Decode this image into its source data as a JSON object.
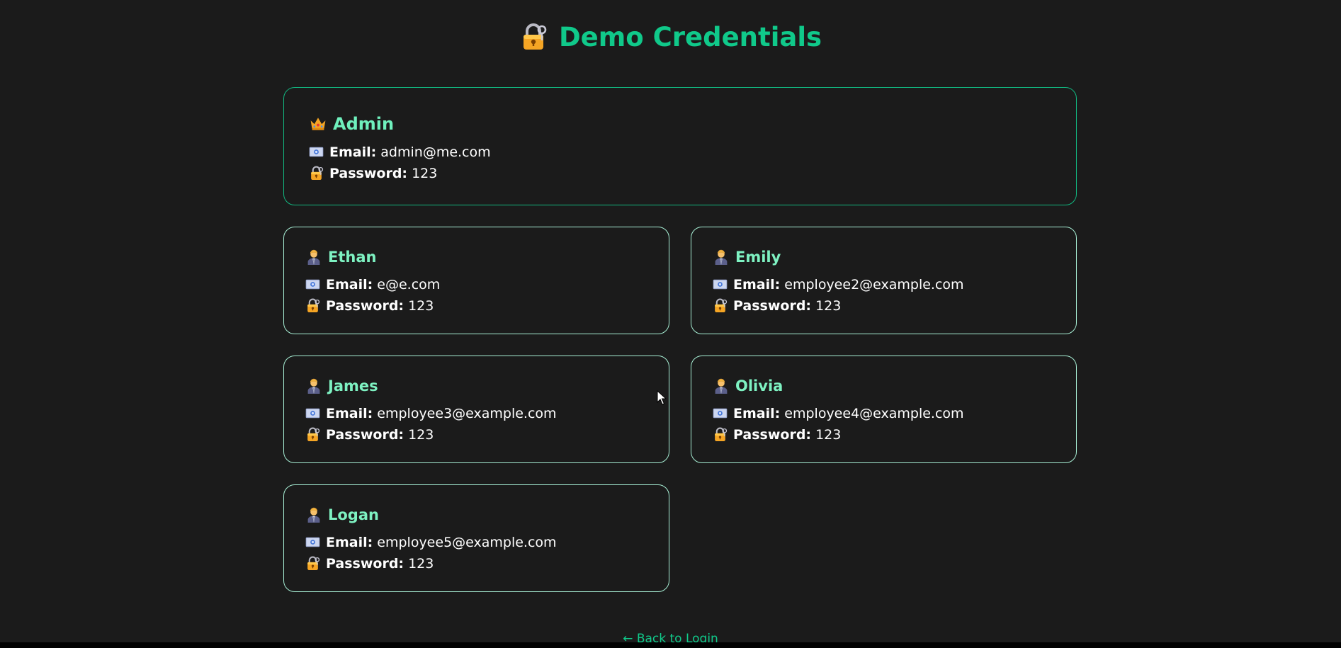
{
  "header": {
    "title": "Demo Credentials",
    "icon": "lock-with-key-icon",
    "title_color": "#10c98a"
  },
  "labels": {
    "email": "Email:",
    "password": "Password:"
  },
  "admin": {
    "name": "Admin",
    "icon": "crown-icon",
    "email": "admin@me.com",
    "password": "123"
  },
  "employees": [
    {
      "name": "Ethan",
      "icon": "office-worker-icon",
      "email": "e@e.com",
      "password": "123"
    },
    {
      "name": "Emily",
      "icon": "office-worker-icon",
      "email": "employee2@example.com",
      "password": "123"
    },
    {
      "name": "James",
      "icon": "office-worker-icon",
      "email": "employee3@example.com",
      "password": "123"
    },
    {
      "name": "Olivia",
      "icon": "office-worker-icon",
      "email": "employee4@example.com",
      "password": "123"
    },
    {
      "name": "Logan",
      "icon": "office-worker-icon",
      "email": "employee5@example.com",
      "password": "123"
    }
  ],
  "footer": {
    "back_link": "← Back to Login"
  },
  "colors": {
    "background": "#1b1b1b",
    "accent": "#10c98a",
    "name": "#7ef2c2",
    "card_border": "#a7efd5"
  }
}
